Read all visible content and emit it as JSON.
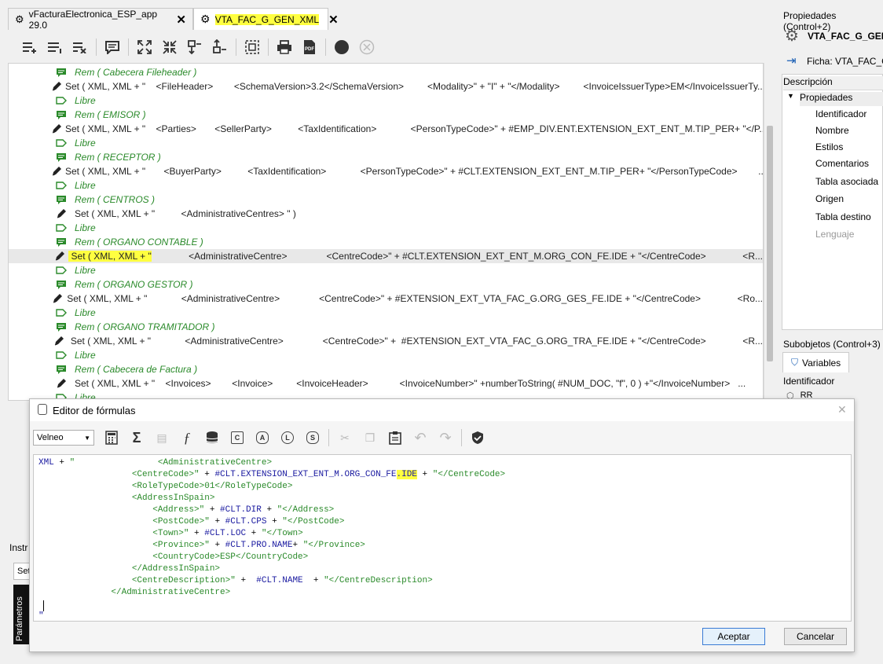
{
  "tabs": [
    {
      "label": "vFacturaElectronica_ESP_app 29.0",
      "active": false
    },
    {
      "label": "VTA_FAC_G_GEN_XML",
      "active": true
    }
  ],
  "code_lines": [
    {
      "type": "rem",
      "text": "Rem ( Cabecera Fileheader )"
    },
    {
      "type": "set",
      "text": "Set ( XML, XML + \"    <FileHeader>        <SchemaVersion>3.2</SchemaVersion>         <Modality>\" + \"I\" + \"</Modality>         <InvoiceIssuerType>EM</InvoiceIssuerTy..."
    },
    {
      "type": "libre",
      "text": "Libre"
    },
    {
      "type": "rem",
      "text": "Rem ( EMISOR )"
    },
    {
      "type": "set",
      "text": "Set ( XML, XML + \"    <Parties>       <SellerParty>          <TaxIdentification>             <PersonTypeCode>\" + #EMP_DIV.ENT.EXTENSION_EXT_ENT_M.TIP_PER+ \"</P..."
    },
    {
      "type": "libre",
      "text": "Libre"
    },
    {
      "type": "rem",
      "text": "Rem ( RECEPTOR )"
    },
    {
      "type": "set",
      "text": "Set ( XML, XML + \"       <BuyerParty>          <TaxIdentification>             <PersonTypeCode>\" + #CLT.EXTENSION_EXT_ENT_M.TIP_PER+ \"</PersonTypeCode>        ..."
    },
    {
      "type": "libre",
      "text": "Libre"
    },
    {
      "type": "rem",
      "text": "Rem ( CENTROS )"
    },
    {
      "type": "set",
      "text": "Set ( XML, XML + \"          <AdministrativeCentres> \" )"
    },
    {
      "type": "libre",
      "text": "Libre"
    },
    {
      "type": "rem",
      "text": "Rem ( ORGANO CONTABLE )"
    },
    {
      "type": "set-sel",
      "text": "Set ( XML, XML + \"",
      "rest": "             <AdministrativeCentre>               <CentreCode>\" + #CLT.EXTENSION_EXT_ENT_M.ORG_CON_FE.IDE + \"</CentreCode>              <R..."
    },
    {
      "type": "libre",
      "text": "Libre"
    },
    {
      "type": "rem",
      "text": "Rem ( ORGANO GESTOR )"
    },
    {
      "type": "set",
      "text": "Set ( XML, XML + \"             <AdministrativeCentre>               <CentreCode>\" + #EXTENSION_EXT_VTA_FAC_G.ORG_GES_FE.IDE + \"</CentreCode>              <Ro..."
    },
    {
      "type": "libre",
      "text": "Libre"
    },
    {
      "type": "rem",
      "text": "Rem ( ORGANO TRAMITADOR )"
    },
    {
      "type": "set",
      "text": "Set ( XML, XML + \"             <AdministrativeCentre>               <CentreCode>\" +  #EXTENSION_EXT_VTA_FAC_G.ORG_TRA_FE.IDE + \"</CentreCode>              <R..."
    },
    {
      "type": "libre",
      "text": "Libre"
    },
    {
      "type": "rem",
      "text": "Rem ( Cabecera de Factura )"
    },
    {
      "type": "set",
      "text": "Set ( XML, XML + \"    <Invoices>        <Invoice>         <InvoiceHeader>            <InvoiceNumber>\" +numberToString( #NUM_DOC, \"f\", 0 ) +\"</InvoiceNumber>   ..."
    },
    {
      "type": "libre",
      "text": "Libre"
    }
  ],
  "right_panel": {
    "header": "Propiedades (Control+2)",
    "object_name": "VTA_FAC_G_GEN_",
    "ficha": "Ficha: VTA_FAC_G@",
    "desc_header": "Descripción",
    "group": "Propiedades",
    "props": [
      "Identificador",
      "Nombre",
      "Estilos",
      "Comentarios",
      "Tabla asociada",
      "Origen",
      "Tabla destino",
      "Lenguaje"
    ],
    "subobj_header": "Subobjetos (Control+3)",
    "variables_tab": "Variables",
    "id_header": "Identificador",
    "first_var": "RR"
  },
  "left_bottom": {
    "instr": "Instr",
    "set": "Set",
    "params": "Parámetros"
  },
  "dialog": {
    "title": "Editor de fórmulas",
    "language": "Velneo",
    "ok": "Aceptar",
    "cancel": "Cancelar",
    "formula": [
      [
        {
          "c": "k",
          "t": "XML"
        },
        {
          "c": "b",
          "t": " + "
        },
        {
          "c": "g",
          "t": "\"                <AdministrativeCentre>"
        }
      ],
      [
        {
          "c": "g",
          "t": "                  <CentreCode>\""
        },
        {
          "c": "b",
          "t": " + "
        },
        {
          "c": "k",
          "t": "#CLT.EXTENSION_EXT_ENT_M.ORG_CON_FE"
        },
        {
          "c": "kh",
          "t": ".IDE"
        },
        {
          "c": "b",
          "t": " + "
        },
        {
          "c": "g",
          "t": "\"</CentreCode>"
        }
      ],
      [
        {
          "c": "g",
          "t": "                  <RoleTypeCode>01</RoleTypeCode>"
        }
      ],
      [
        {
          "c": "g",
          "t": "                  <AddressInSpain>"
        }
      ],
      [
        {
          "c": "g",
          "t": "                      <Address>\""
        },
        {
          "c": "b",
          "t": " + "
        },
        {
          "c": "k",
          "t": "#CLT.DIR"
        },
        {
          "c": "b",
          "t": " + "
        },
        {
          "c": "g",
          "t": "\"</Address>"
        }
      ],
      [
        {
          "c": "g",
          "t": "                      <PostCode>\""
        },
        {
          "c": "b",
          "t": " + "
        },
        {
          "c": "k",
          "t": "#CLT.CPS"
        },
        {
          "c": "b",
          "t": " + "
        },
        {
          "c": "g",
          "t": "\"</PostCode>"
        }
      ],
      [
        {
          "c": "g",
          "t": "                      <Town>\""
        },
        {
          "c": "b",
          "t": " + "
        },
        {
          "c": "k",
          "t": "#CLT.LOC"
        },
        {
          "c": "b",
          "t": " + "
        },
        {
          "c": "g",
          "t": "\"</Town>"
        }
      ],
      [
        {
          "c": "g",
          "t": "                      <Province>\""
        },
        {
          "c": "b",
          "t": " + "
        },
        {
          "c": "k",
          "t": "#CLT.PRO.NAME"
        },
        {
          "c": "b",
          "t": "+ "
        },
        {
          "c": "g",
          "t": "\"</Province>"
        }
      ],
      [
        {
          "c": "g",
          "t": "                      <CountryCode>ESP</CountryCode>"
        }
      ],
      [
        {
          "c": "g",
          "t": "                  </AddressInSpain>"
        }
      ],
      [
        {
          "c": "g",
          "t": "                  <CentreDescription>\""
        },
        {
          "c": "b",
          "t": " +  "
        },
        {
          "c": "k",
          "t": "#CLT.NAME"
        },
        {
          "c": "b",
          "t": "  + "
        },
        {
          "c": "g",
          "t": "\"</CentreDescription>"
        }
      ],
      [
        {
          "c": "g",
          "t": "              </AdministrativeCentre>"
        }
      ],
      [
        {
          "c": "g",
          "t": ""
        }
      ],
      [
        {
          "c": "k",
          "t": "\""
        }
      ]
    ]
  }
}
